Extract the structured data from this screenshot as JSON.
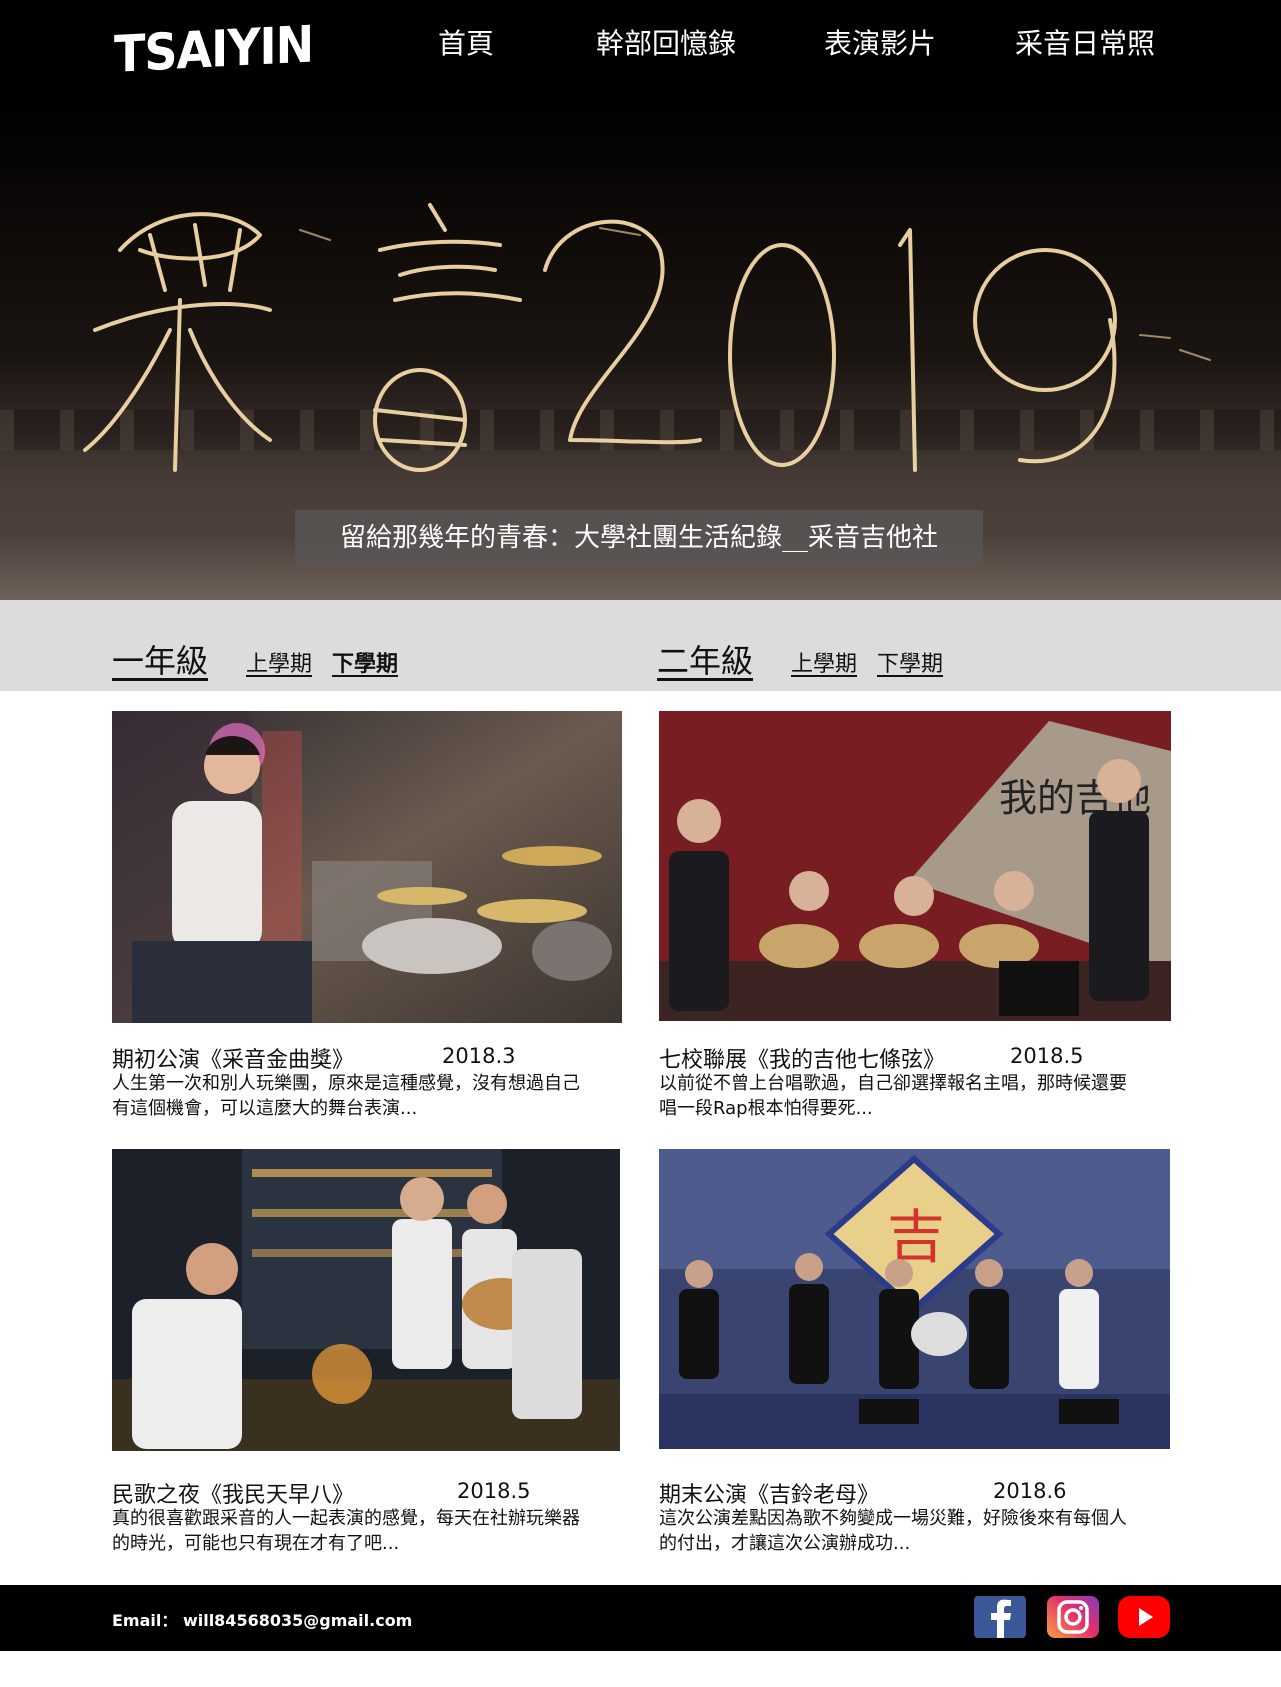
{
  "header": {
    "logo_text": "TSAIYIN",
    "nav": [
      "首頁",
      "幹部回憶錄",
      "表演影片",
      "采音日常照"
    ]
  },
  "hero": {
    "tagline": "留給那幾年的青春：大學社團生活紀錄__采音吉他社"
  },
  "grades": [
    {
      "label": "一年級",
      "terms": [
        "上學期",
        "下學期"
      ],
      "active_term": "下學期"
    },
    {
      "label": "二年級",
      "terms": [
        "上學期",
        "下學期"
      ]
    }
  ],
  "events": [
    {
      "title": "期初公演《采音金曲獎》",
      "date": "2018.3",
      "desc": "人生第一次和別人玩樂團，原來是這種感覺，沒有想過自己有這個機會，可以這麼大的舞台表演..."
    },
    {
      "title": "七校聯展《我的吉他七條弦》",
      "date": "2018.5",
      "desc": "以前從不曾上台唱歌過，自己卻選擇報名主唱，那時候還要唱一段Rap根本怕得要死..."
    },
    {
      "title": "民歌之夜《我民天早八》",
      "date": "2018.5",
      "desc": "真的很喜歡跟采音的人一起表演的感覺，每天在社辦玩樂器的時光，可能也只有現在才有了吧..."
    },
    {
      "title": "期末公演《吉鈴老母》",
      "date": "2018.6",
      "desc": "這次公演差點因為歌不夠變成一場災難，好險後來有每個人的付出，才讓這次公演辦成功..."
    }
  ],
  "footer": {
    "email": "Email： will84568035@gmail.com",
    "social": [
      "facebook-icon",
      "instagram-icon",
      "youtube-icon"
    ]
  },
  "colors": {
    "header_bg": "#000000",
    "grade_bar_bg": "#dcdcdc",
    "footer_bg": "#000000",
    "facebook": "#3b5998",
    "youtube": "#ff0000"
  }
}
